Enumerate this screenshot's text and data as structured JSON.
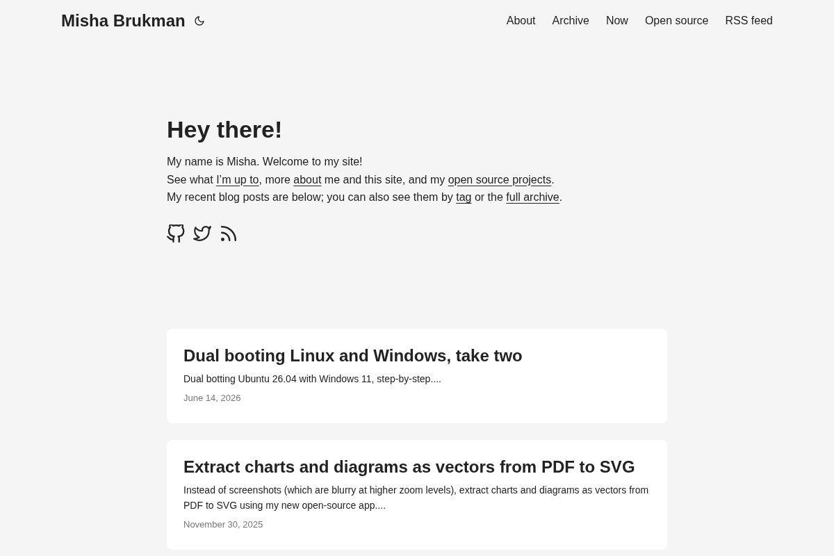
{
  "header": {
    "site_title": "Misha Brukman",
    "nav": [
      {
        "label": "About"
      },
      {
        "label": "Archive"
      },
      {
        "label": "Now"
      },
      {
        "label": "Open source"
      },
      {
        "label": "RSS feed"
      }
    ]
  },
  "intro": {
    "heading": "Hey there!",
    "lines": [
      {
        "segments": [
          {
            "kind": "text",
            "text": "My name is Misha. Welcome to my site!"
          }
        ]
      },
      {
        "segments": [
          {
            "kind": "text",
            "text": "See what "
          },
          {
            "kind": "link",
            "text": "I’m up to"
          },
          {
            "kind": "text",
            "text": ", more "
          },
          {
            "kind": "link",
            "text": "about"
          },
          {
            "kind": "text",
            "text": " me and this site, and my "
          },
          {
            "kind": "link",
            "text": "open source projects"
          },
          {
            "kind": "text",
            "text": "."
          }
        ]
      },
      {
        "segments": [
          {
            "kind": "text",
            "text": "My recent blog posts are below; you can also see them by "
          },
          {
            "kind": "link",
            "text": "tag"
          },
          {
            "kind": "text",
            "text": " or the "
          },
          {
            "kind": "link",
            "text": "full archive"
          },
          {
            "kind": "text",
            "text": "."
          }
        ]
      }
    ],
    "social": [
      {
        "kind": "github"
      },
      {
        "kind": "twitter"
      },
      {
        "kind": "rss"
      }
    ]
  },
  "posts": [
    {
      "title": "Dual booting Linux and Windows, take two",
      "excerpt": "Dual botting Ubuntu 26.04 with Windows 11, step-by-step....",
      "date": "June 14, 2026"
    },
    {
      "title": "Extract charts and diagrams as vectors from PDF to SVG",
      "excerpt": "Instead of screenshots (which are blurry at higher zoom levels), extract charts and diagrams as vectors from PDF to SVG using my new open-source app....",
      "date": "November 30, 2025"
    }
  ]
}
